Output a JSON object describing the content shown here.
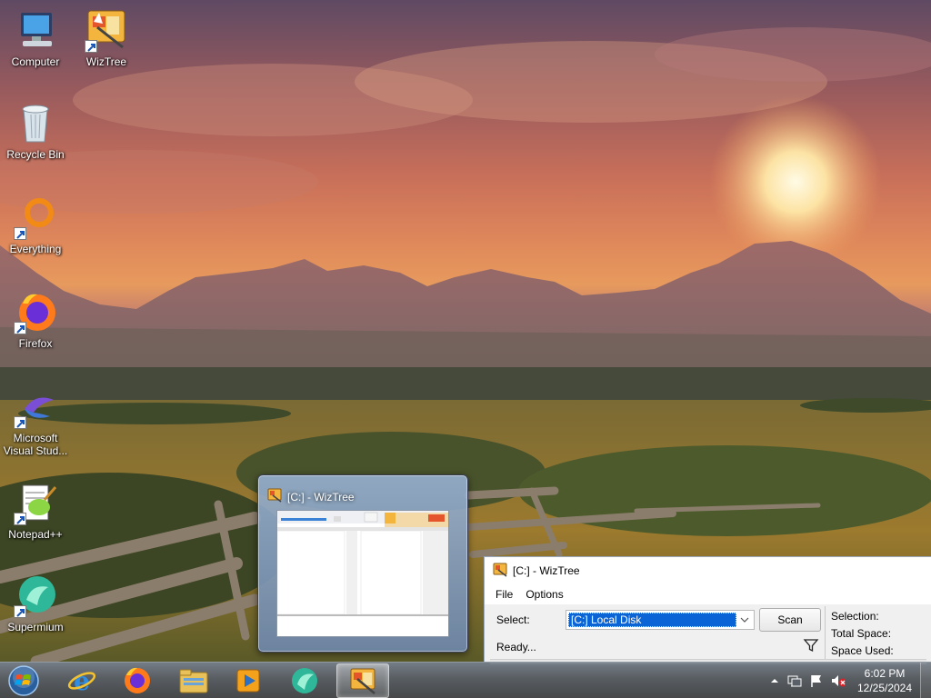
{
  "desktop_icons": [
    {
      "label": "Computer",
      "icon": "computer-icon"
    },
    {
      "label": "WizTree",
      "icon": "wiztree-icon"
    },
    {
      "label": "Recycle Bin",
      "icon": "recycle-bin-icon"
    },
    {
      "label": "Everything",
      "icon": "everything-icon"
    },
    {
      "label": "Firefox",
      "icon": "firefox-icon"
    },
    {
      "label": "Microsoft Visual Stud...",
      "icon": "visual-studio-icon"
    },
    {
      "label": "Notepad++",
      "icon": "notepadpp-icon"
    },
    {
      "label": "Supermium",
      "icon": "supermium-icon"
    }
  ],
  "preview": {
    "title": "[C:]  - WizTree"
  },
  "wiztree": {
    "title": "[C:]  - WizTree",
    "menu": [
      "File",
      "Options"
    ],
    "select_label": "Select:",
    "drive_value": "[C:] Local Disk",
    "scan_label": "Scan",
    "status": "Ready...",
    "info_labels": [
      "Selection:",
      "Total Space:",
      "Space Used:"
    ]
  },
  "taskbar": {
    "apps": [
      "Internet Explorer",
      "Firefox",
      "File Explorer",
      "Windows Media Player",
      "Supermium",
      "WizTree"
    ],
    "time": "6:02 PM",
    "date": "12/25/2024"
  },
  "colors": {
    "selection_blue": "#0a64d6",
    "taskbar": "#5a5f64",
    "window_bg": "#f0f0f0"
  }
}
